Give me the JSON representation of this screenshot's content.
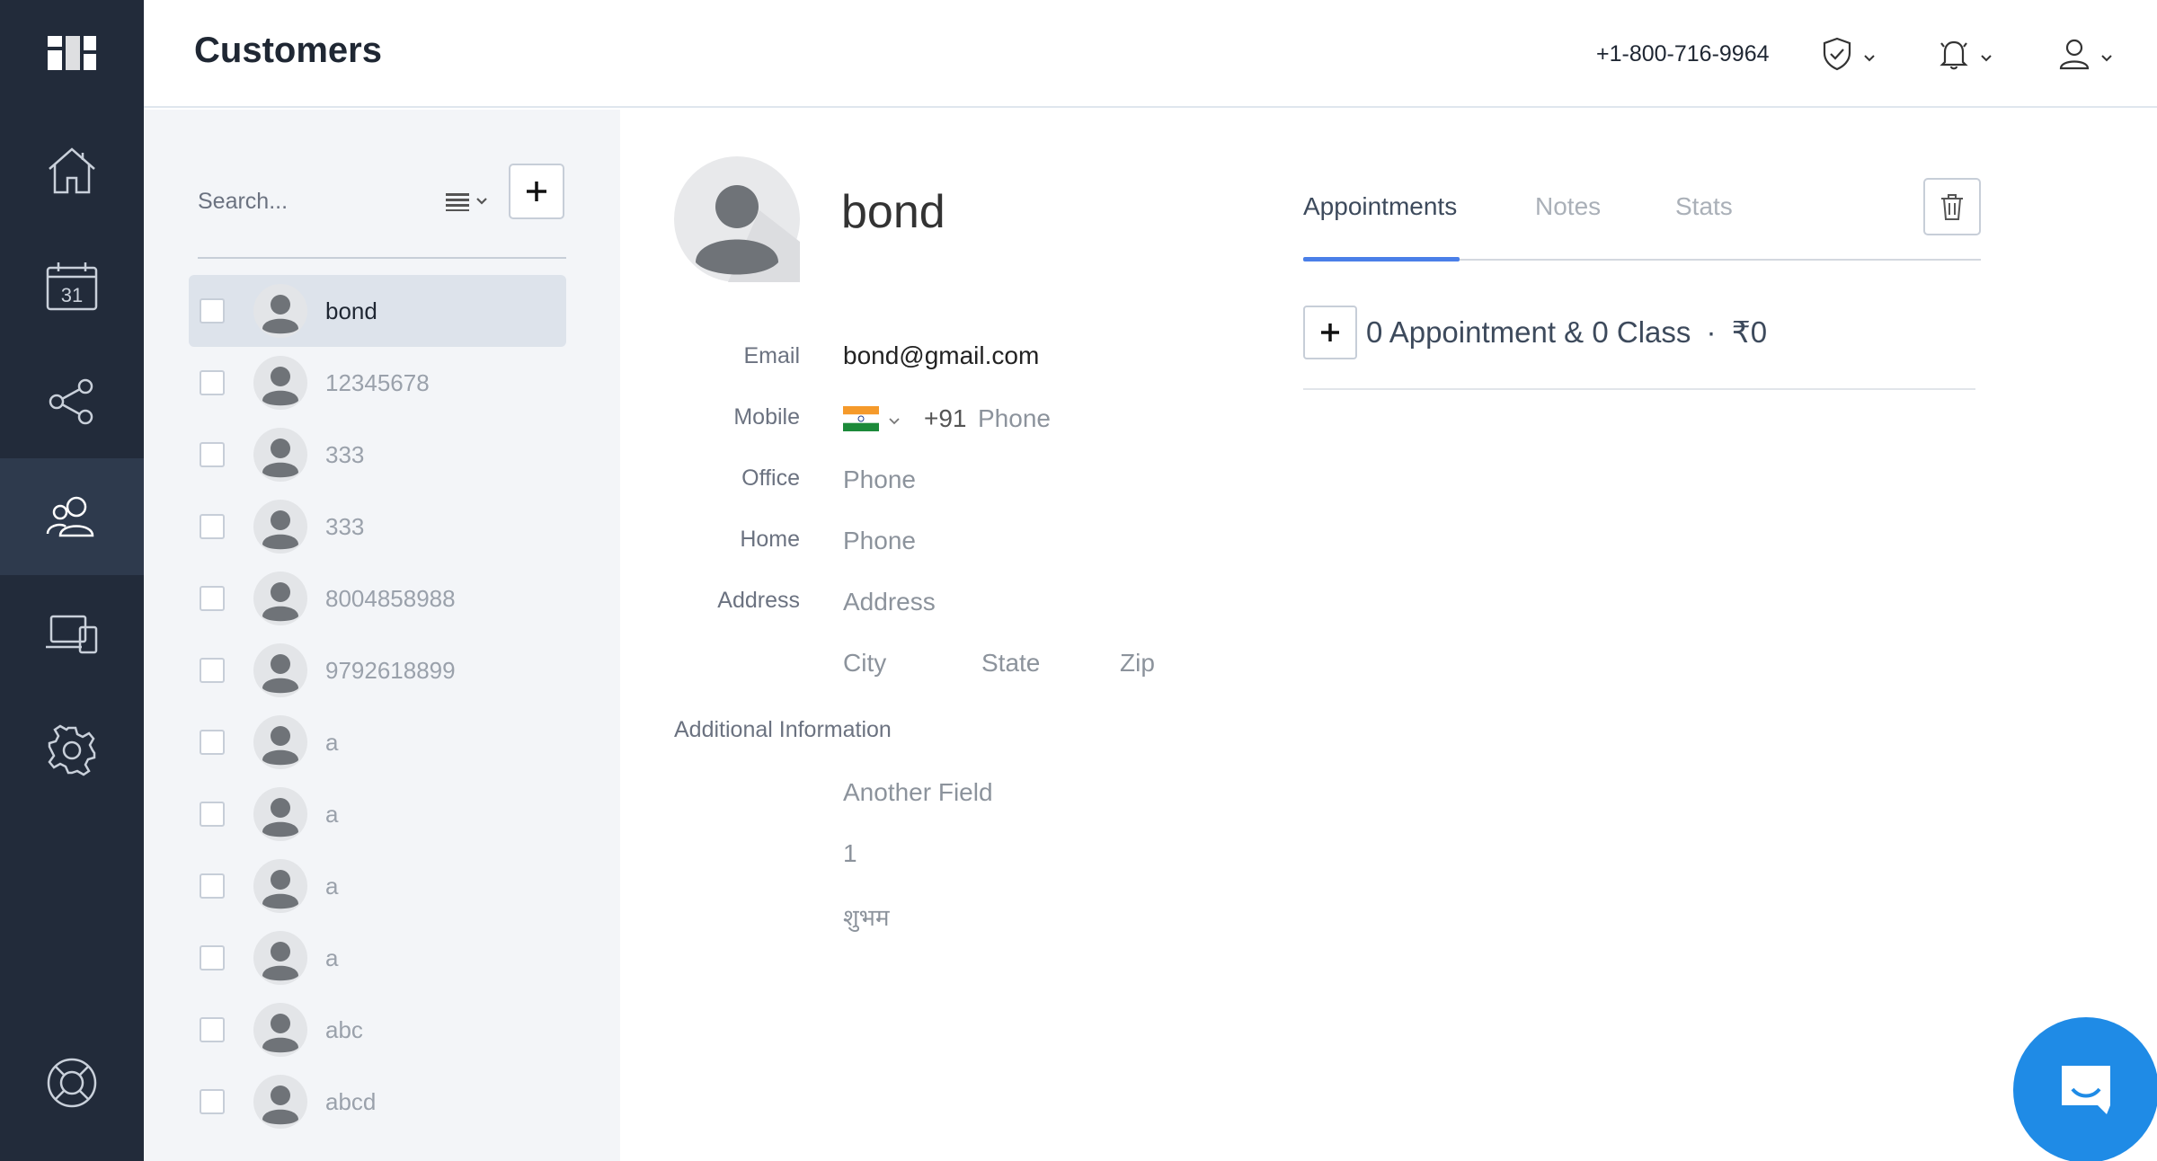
{
  "header": {
    "title": "Customers",
    "phone": "+1-800-716-9964"
  },
  "nav": {
    "items": [
      "dashboard-icon",
      "home-icon",
      "calendar-icon",
      "share-icon",
      "customers-icon",
      "devices-icon",
      "settings-icon",
      "help-icon"
    ],
    "calendar_day": "31",
    "active": "customers"
  },
  "list": {
    "search_placeholder": "Search...",
    "customers": [
      {
        "name": "bond",
        "selected": true
      },
      {
        "name": "12345678"
      },
      {
        "name": "333"
      },
      {
        "name": "333"
      },
      {
        "name": "8004858988"
      },
      {
        "name": "9792618899"
      },
      {
        "name": "a"
      },
      {
        "name": "a"
      },
      {
        "name": "a"
      },
      {
        "name": "a"
      },
      {
        "name": "abc"
      },
      {
        "name": "abcd"
      }
    ]
  },
  "detail": {
    "name": "bond",
    "labels": {
      "email": "Email",
      "mobile": "Mobile",
      "office": "Office",
      "home": "Home",
      "address": "Address"
    },
    "email": "bond@gmail.com",
    "mobile_code": "+91",
    "mobile_placeholder": "Phone",
    "office_placeholder": "Phone",
    "home_placeholder": "Phone",
    "address_placeholder": "Address",
    "city_placeholder": "City",
    "state_placeholder": "State",
    "zip_placeholder": "Zip",
    "additional_title": "Additional Information",
    "additional_fields": [
      "Another Field",
      "1",
      "शुभम"
    ]
  },
  "tabs": {
    "items": [
      "Appointments",
      "Notes",
      "Stats"
    ],
    "active": "Appointments",
    "accent_color": "#4a7fe8"
  },
  "appointments": {
    "summary": "0 Appointment & 0 Class",
    "separator": "·",
    "amount": "₹0"
  },
  "colors": {
    "nav_bg": "#222b3a",
    "nav_active_bg": "#2e3a4d",
    "chat_fab": "#1f8be6"
  }
}
